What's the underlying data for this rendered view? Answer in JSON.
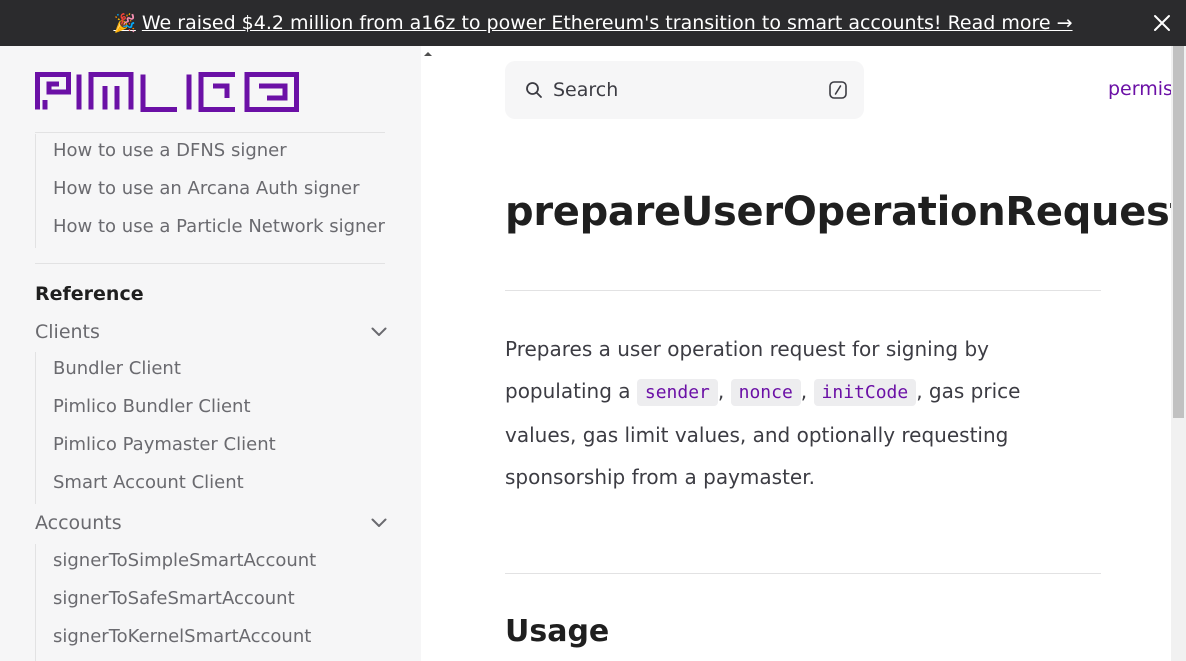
{
  "banner": {
    "emoji": "🎉",
    "text": "We raised $4.2 million from a16z to power Ethereum's transition to smart accounts! Read more →",
    "close_icon": "close-icon",
    "background": "#2b2b2d"
  },
  "brand": {
    "logo_text": "PIMLICO",
    "accent": "#6b10a6"
  },
  "sidebar": {
    "previous_items": [
      "How to use a DFNS signer",
      "How to use an Arcana Auth signer",
      "How to use a Particle Network signer"
    ],
    "section_title": "Reference",
    "groups": [
      {
        "label": "Clients",
        "icon": "chevron-down-icon",
        "items": [
          "Bundler Client",
          "Pimlico Bundler Client",
          "Pimlico Paymaster Client",
          "Smart Account Client"
        ]
      },
      {
        "label": "Accounts",
        "icon": "chevron-down-icon",
        "items": [
          "signerToSimpleSmartAccount",
          "signerToSafeSmartAccount",
          "signerToKernelSmartAccount"
        ]
      }
    ]
  },
  "header": {
    "search_placeholder": "Search",
    "search_icon": "search-icon",
    "shortcut_icon": "slash-key-icon",
    "nav_link": "permis"
  },
  "main": {
    "title": "prepareUserOperationRequest",
    "description": {
      "part1": "Prepares a user operation request for signing by populating a ",
      "code1": "sender",
      "sep1": ", ",
      "code2": "nonce",
      "sep2": ", ",
      "code3": "initCode",
      "part2": ", gas price values, gas limit values, and optionally requesting sponsorship from a paymaster."
    },
    "usage_heading": "Usage"
  }
}
